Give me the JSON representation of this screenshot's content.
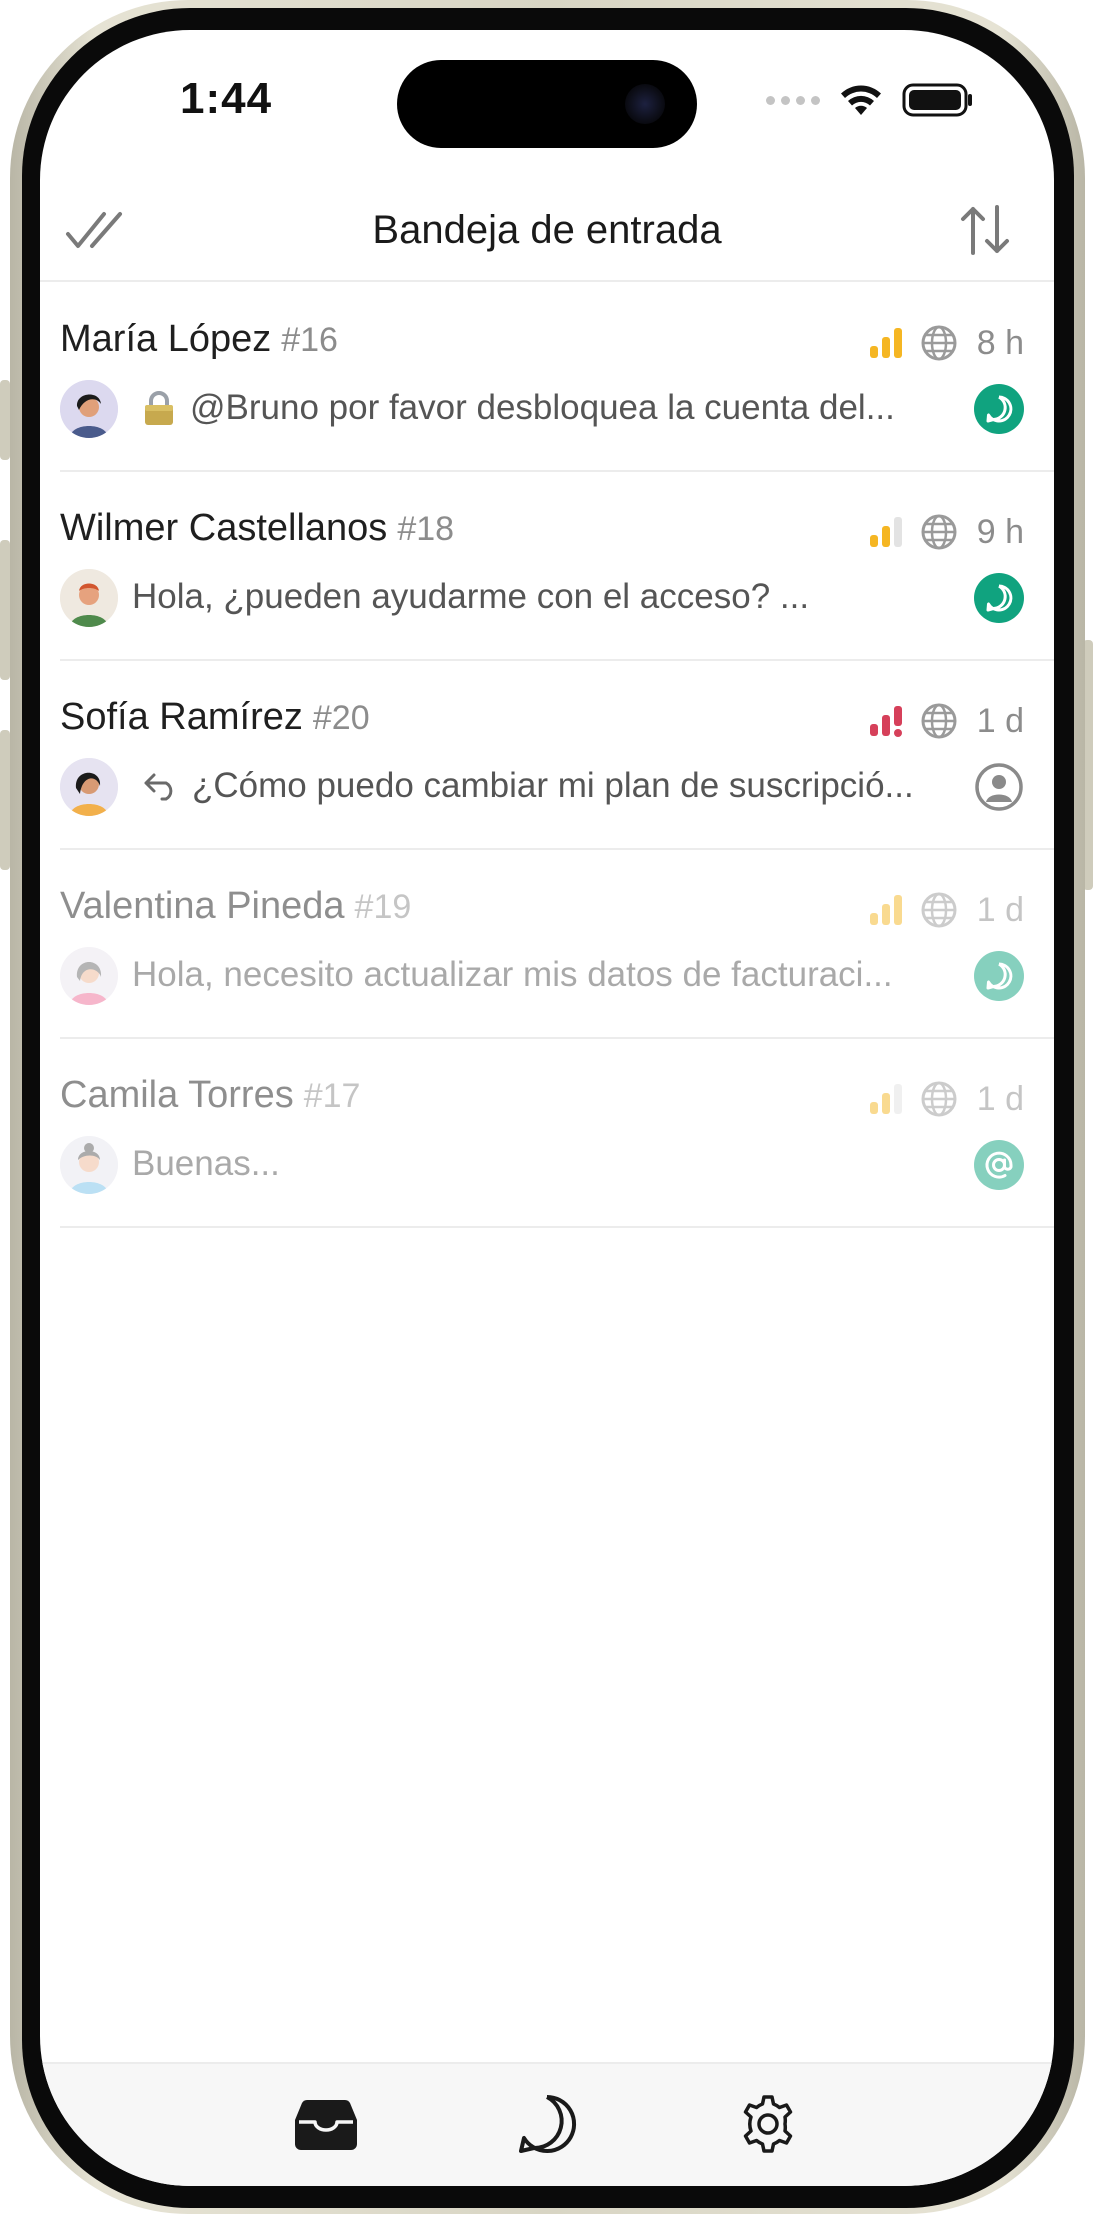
{
  "status_bar": {
    "time": "1:44"
  },
  "header": {
    "title": "Bandeja de entrada",
    "mark_all_read_icon": "double-check-icon",
    "sort_icon": "sort-arrows-icon"
  },
  "conversations": [
    {
      "name": "María López",
      "number": "#16",
      "time": "8 h",
      "priority": "medium",
      "priority_color": "#f5b623",
      "preview": "@Bruno por favor desbloquea la cuenta del...",
      "preview_prefix_icon": "lock-icon",
      "channel_icon": "chat-icon",
      "channel_color": "#10a37f",
      "faded": false
    },
    {
      "name": "Wilmer Castellanos",
      "number": "#18",
      "time": "9 h",
      "priority": "low",
      "priority_color": "#f5b623",
      "preview": "Hola, ¿pueden ayudarme con el acceso? ...",
      "preview_prefix_icon": "",
      "channel_icon": "chat-icon",
      "channel_color": "#10a37f",
      "faded": false
    },
    {
      "name": "Sofía Ramírez",
      "number": "#20",
      "time": "1 d",
      "priority": "urgent",
      "priority_color": "#d6405a",
      "preview": "¿Cómo puedo cambiar mi plan de suscripció...",
      "preview_prefix_icon": "reply-icon",
      "channel_icon": "user-circle-icon",
      "channel_color": "#8a8a8a",
      "faded": false
    },
    {
      "name": "Valentina Pineda",
      "number": "#19",
      "time": "1 d",
      "priority": "medium",
      "priority_color": "#f5b623",
      "preview": "Hola, necesito actualizar mis datos de facturaci...",
      "preview_prefix_icon": "",
      "channel_icon": "chat-icon",
      "channel_color": "#10a37f",
      "faded": true
    },
    {
      "name": "Camila Torres",
      "number": "#17",
      "time": "1 d",
      "priority": "low",
      "priority_color": "#f5b623",
      "preview": "Buenas...",
      "preview_prefix_icon": "",
      "channel_icon": "at-sign-icon",
      "channel_color": "#10a37f",
      "faded": true
    }
  ],
  "tabbar": {
    "tabs": [
      {
        "icon": "inbox-icon",
        "active": true
      },
      {
        "icon": "chat-bubble-icon",
        "active": false
      },
      {
        "icon": "settings-gear-icon",
        "active": false
      }
    ]
  }
}
